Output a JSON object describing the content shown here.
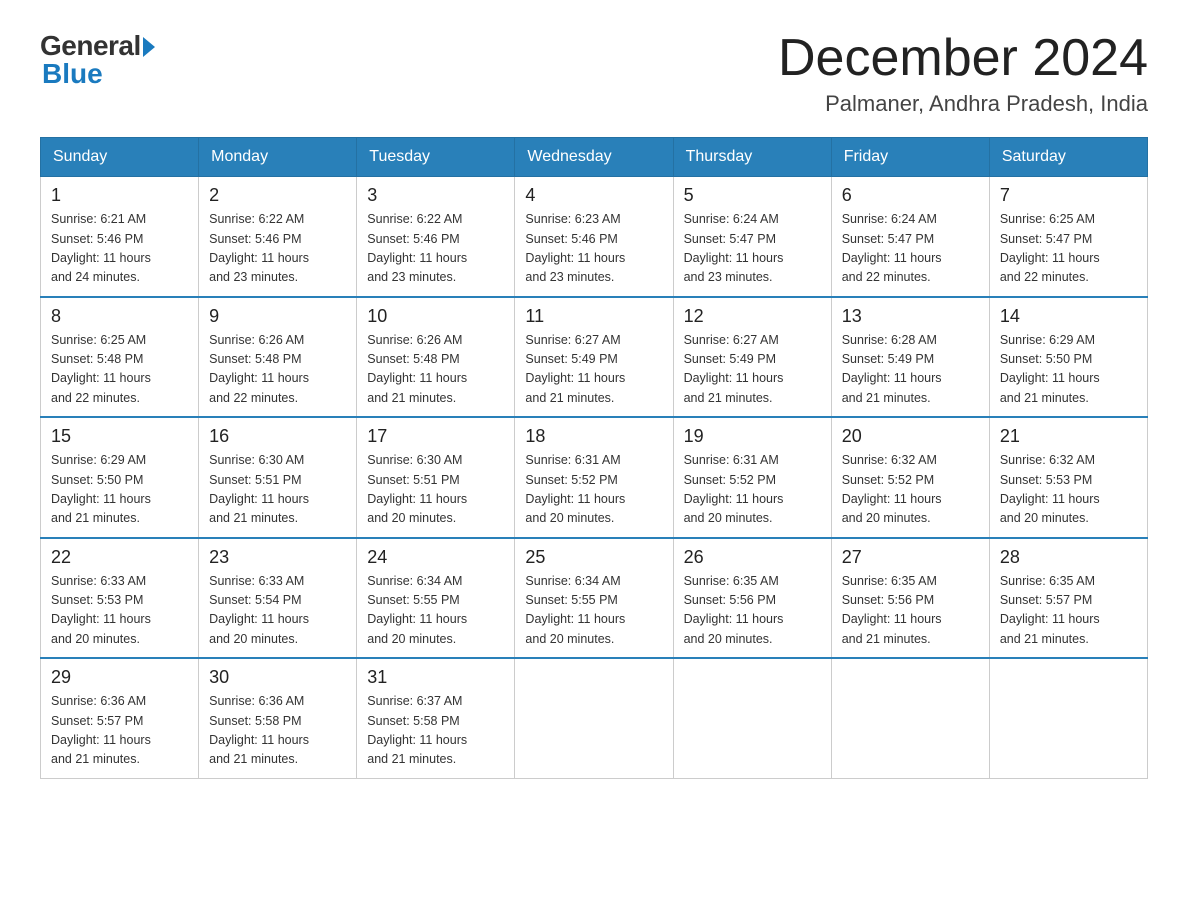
{
  "logo": {
    "general": "General",
    "blue": "Blue"
  },
  "header": {
    "month": "December 2024",
    "location": "Palmaner, Andhra Pradesh, India"
  },
  "days_of_week": [
    "Sunday",
    "Monday",
    "Tuesday",
    "Wednesday",
    "Thursday",
    "Friday",
    "Saturday"
  ],
  "weeks": [
    [
      {
        "day": "1",
        "sunrise": "6:21 AM",
        "sunset": "5:46 PM",
        "daylight": "11 hours and 24 minutes."
      },
      {
        "day": "2",
        "sunrise": "6:22 AM",
        "sunset": "5:46 PM",
        "daylight": "11 hours and 23 minutes."
      },
      {
        "day": "3",
        "sunrise": "6:22 AM",
        "sunset": "5:46 PM",
        "daylight": "11 hours and 23 minutes."
      },
      {
        "day": "4",
        "sunrise": "6:23 AM",
        "sunset": "5:46 PM",
        "daylight": "11 hours and 23 minutes."
      },
      {
        "day": "5",
        "sunrise": "6:24 AM",
        "sunset": "5:47 PM",
        "daylight": "11 hours and 23 minutes."
      },
      {
        "day": "6",
        "sunrise": "6:24 AM",
        "sunset": "5:47 PM",
        "daylight": "11 hours and 22 minutes."
      },
      {
        "day": "7",
        "sunrise": "6:25 AM",
        "sunset": "5:47 PM",
        "daylight": "11 hours and 22 minutes."
      }
    ],
    [
      {
        "day": "8",
        "sunrise": "6:25 AM",
        "sunset": "5:48 PM",
        "daylight": "11 hours and 22 minutes."
      },
      {
        "day": "9",
        "sunrise": "6:26 AM",
        "sunset": "5:48 PM",
        "daylight": "11 hours and 22 minutes."
      },
      {
        "day": "10",
        "sunrise": "6:26 AM",
        "sunset": "5:48 PM",
        "daylight": "11 hours and 21 minutes."
      },
      {
        "day": "11",
        "sunrise": "6:27 AM",
        "sunset": "5:49 PM",
        "daylight": "11 hours and 21 minutes."
      },
      {
        "day": "12",
        "sunrise": "6:27 AM",
        "sunset": "5:49 PM",
        "daylight": "11 hours and 21 minutes."
      },
      {
        "day": "13",
        "sunrise": "6:28 AM",
        "sunset": "5:49 PM",
        "daylight": "11 hours and 21 minutes."
      },
      {
        "day": "14",
        "sunrise": "6:29 AM",
        "sunset": "5:50 PM",
        "daylight": "11 hours and 21 minutes."
      }
    ],
    [
      {
        "day": "15",
        "sunrise": "6:29 AM",
        "sunset": "5:50 PM",
        "daylight": "11 hours and 21 minutes."
      },
      {
        "day": "16",
        "sunrise": "6:30 AM",
        "sunset": "5:51 PM",
        "daylight": "11 hours and 21 minutes."
      },
      {
        "day": "17",
        "sunrise": "6:30 AM",
        "sunset": "5:51 PM",
        "daylight": "11 hours and 20 minutes."
      },
      {
        "day": "18",
        "sunrise": "6:31 AM",
        "sunset": "5:52 PM",
        "daylight": "11 hours and 20 minutes."
      },
      {
        "day": "19",
        "sunrise": "6:31 AM",
        "sunset": "5:52 PM",
        "daylight": "11 hours and 20 minutes."
      },
      {
        "day": "20",
        "sunrise": "6:32 AM",
        "sunset": "5:52 PM",
        "daylight": "11 hours and 20 minutes."
      },
      {
        "day": "21",
        "sunrise": "6:32 AM",
        "sunset": "5:53 PM",
        "daylight": "11 hours and 20 minutes."
      }
    ],
    [
      {
        "day": "22",
        "sunrise": "6:33 AM",
        "sunset": "5:53 PM",
        "daylight": "11 hours and 20 minutes."
      },
      {
        "day": "23",
        "sunrise": "6:33 AM",
        "sunset": "5:54 PM",
        "daylight": "11 hours and 20 minutes."
      },
      {
        "day": "24",
        "sunrise": "6:34 AM",
        "sunset": "5:55 PM",
        "daylight": "11 hours and 20 minutes."
      },
      {
        "day": "25",
        "sunrise": "6:34 AM",
        "sunset": "5:55 PM",
        "daylight": "11 hours and 20 minutes."
      },
      {
        "day": "26",
        "sunrise": "6:35 AM",
        "sunset": "5:56 PM",
        "daylight": "11 hours and 20 minutes."
      },
      {
        "day": "27",
        "sunrise": "6:35 AM",
        "sunset": "5:56 PM",
        "daylight": "11 hours and 21 minutes."
      },
      {
        "day": "28",
        "sunrise": "6:35 AM",
        "sunset": "5:57 PM",
        "daylight": "11 hours and 21 minutes."
      }
    ],
    [
      {
        "day": "29",
        "sunrise": "6:36 AM",
        "sunset": "5:57 PM",
        "daylight": "11 hours and 21 minutes."
      },
      {
        "day": "30",
        "sunrise": "6:36 AM",
        "sunset": "5:58 PM",
        "daylight": "11 hours and 21 minutes."
      },
      {
        "day": "31",
        "sunrise": "6:37 AM",
        "sunset": "5:58 PM",
        "daylight": "11 hours and 21 minutes."
      },
      null,
      null,
      null,
      null
    ]
  ],
  "labels": {
    "sunrise": "Sunrise:",
    "sunset": "Sunset:",
    "daylight": "Daylight:"
  }
}
